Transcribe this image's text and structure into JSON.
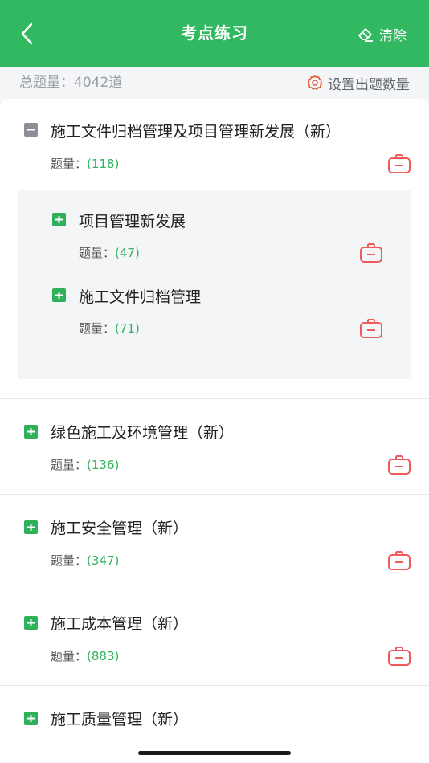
{
  "header": {
    "title": "考点练习",
    "clear_label": "清除"
  },
  "summary": {
    "total_label": "总题量：4042道",
    "setting_label": "设置出题数量"
  },
  "count_prefix": "题量：",
  "sections": [
    {
      "title": "施工文件归档管理及项目管理新发展（新）",
      "count": "(118)",
      "expanded": true,
      "children": [
        {
          "title": "项目管理新发展",
          "count": "(47)"
        },
        {
          "title": "施工文件归档管理",
          "count": "(71)"
        }
      ]
    },
    {
      "title": "绿色施工及环境管理（新）",
      "count": "(136)",
      "expanded": false
    },
    {
      "title": "施工安全管理（新）",
      "count": "(347)",
      "expanded": false
    },
    {
      "title": "施工成本管理（新）",
      "count": "(883)",
      "expanded": false
    },
    {
      "title": "施工质量管理（新）",
      "count": "",
      "expanded": false
    }
  ],
  "colors": {
    "brand_green": "#33b862",
    "count_green": "#2fb15c",
    "kit_red": "#f05a5a"
  },
  "icons": {
    "back": "chevron-left-icon",
    "clear": "eraser-icon",
    "setting": "gear-icon",
    "expand": "plus-square-icon",
    "collapse": "minus-square-icon",
    "practice": "medical-kit-icon"
  }
}
